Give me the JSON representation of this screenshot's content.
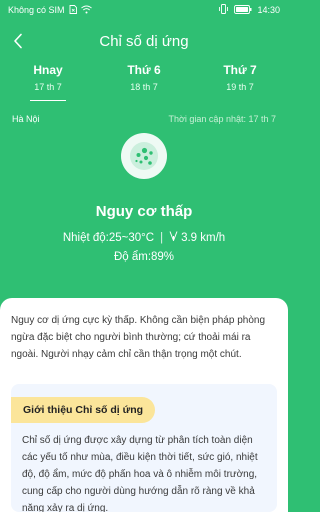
{
  "status_bar": {
    "carrier": "Không có SIM",
    "time": "14:30"
  },
  "header": {
    "title": "Chỉ số dị ứng",
    "back_icon": "chevron-left-icon"
  },
  "tabs": [
    {
      "name": "Hnay",
      "date": "17 th 7",
      "active": true
    },
    {
      "name": "Thứ 6",
      "date": "18 th 7",
      "active": false
    },
    {
      "name": "Thứ 7",
      "date": "19 th 7",
      "active": false
    }
  ],
  "info": {
    "city": "Hà Nội",
    "updated": "Thời gian cập nhật: 17 th 7"
  },
  "current": {
    "icon": "pollen-icon",
    "level": "Nguy cơ thấp",
    "temperature": "Nhiệt độ:25~30°C",
    "wind": "3.9 km/h",
    "humidity": "Độ ẩm:89%"
  },
  "card": {
    "advice": "Nguy cơ dị ứng cực kỳ thấp. Không cần biện pháp phòng ngừa đặc biệt cho người bình thường; cứ thoải mái ra ngoài. Người nhạy cảm chỉ cần thận trọng một chút.",
    "intro_title": "Giới thiệu Chỉ số dị ứng",
    "intro_text": "Chỉ số dị ứng được xây dựng từ phân tích toàn diện các yếu tố như mùa, điều kiện thời tiết, sức gió, nhiệt độ, độ ẩm, mức độ phấn hoa và ô nhiễm môi trường, cung cấp cho người dùng hướng dẫn rõ ràng về khả năng xảy ra dị ứng."
  },
  "colors": {
    "background": "#2fbf73",
    "card": "#ffffff",
    "intro_box": "#f1f6fe",
    "intro_tag": "#fbe59a"
  }
}
